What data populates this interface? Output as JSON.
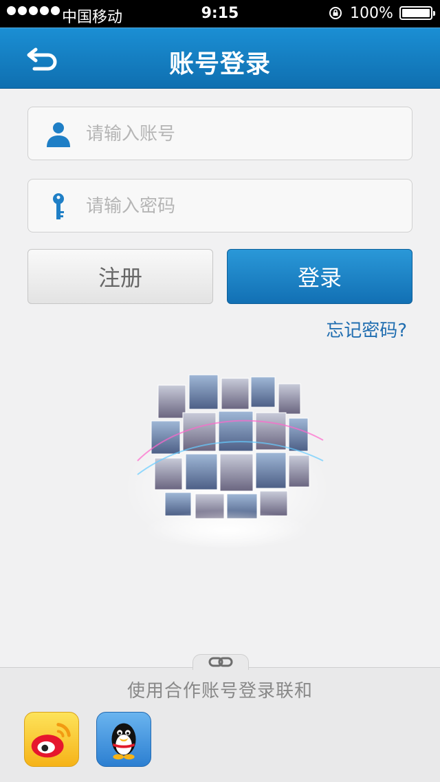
{
  "status_bar": {
    "carrier": "中国移动",
    "time": "9:15",
    "battery": "100%"
  },
  "nav": {
    "title": "账号登录",
    "back_icon": "back-arrow-icon"
  },
  "form": {
    "account_placeholder": "请输入账号",
    "password_placeholder": "请输入密码",
    "register_label": "注册",
    "login_label": "登录",
    "forgot_label": "忘记密码?"
  },
  "footer": {
    "hint": "使用合作账号登录联和",
    "partners": [
      "weibo-icon",
      "qq-icon"
    ]
  },
  "colors": {
    "nav_blue": "#1582c6",
    "login_blue": "#1a80c4",
    "link_blue": "#1f6db0"
  }
}
